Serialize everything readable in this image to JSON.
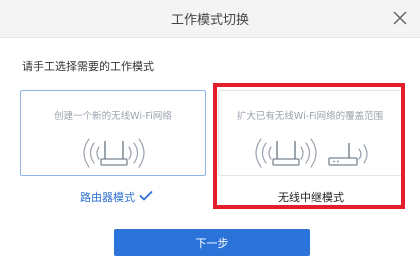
{
  "dialog": {
    "title": "工作模式切换",
    "prompt": "请手工选择需要的工作模式"
  },
  "options": {
    "router": {
      "description": "创建一个新的无线Wi-Fi网络",
      "label": "路由器模式",
      "selected": true
    },
    "repeater": {
      "description": "扩大已有无线Wi-Fi网络的覆盖范围",
      "label": "无线中继模式",
      "selected": false
    }
  },
  "next_button": {
    "label": "下一步"
  },
  "colors": {
    "accent": "#2b73d8",
    "highlight": "#e41e2b",
    "selected_border": "#8fb4e6"
  },
  "icons": {
    "close": "close-icon",
    "router": "router-wifi-icon",
    "repeater": "repeater-wifi-icon",
    "check": "check-icon"
  }
}
